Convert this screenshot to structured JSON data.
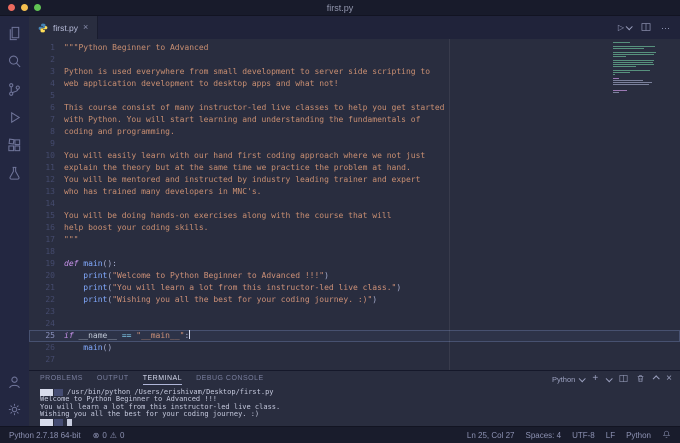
{
  "window": {
    "title": "first.py"
  },
  "colors": {
    "traffic_red": "#ec6a5e",
    "traffic_yellow": "#f4bf4f",
    "traffic_green": "#61c454",
    "editor_bg": "#292d3f",
    "keyword": "#c792ea",
    "string": "#ce9178",
    "function": "#82aaff",
    "operator": "#89ddff"
  },
  "activity_bar": {
    "items": [
      "explorer",
      "search",
      "source-control",
      "run-and-debug",
      "extensions",
      "testing"
    ],
    "bottom_items": [
      "account",
      "settings"
    ]
  },
  "tab_bar": {
    "tabs": [
      {
        "label": "first.py",
        "active": true
      }
    ],
    "actions": {
      "run": "▷",
      "more": "···"
    }
  },
  "editor": {
    "current_line": 25,
    "ruler_column": 80,
    "lines": [
      {
        "n": 1,
        "t": [
          [
            "ds",
            "\"\"\"Python Beginner to Advanced"
          ]
        ]
      },
      {
        "n": 2,
        "t": []
      },
      {
        "n": 3,
        "t": [
          [
            "ds",
            "Python is used everywhere from small development to server side scripting to"
          ]
        ]
      },
      {
        "n": 4,
        "t": [
          [
            "ds",
            "web application development to desktop apps and what not!"
          ]
        ]
      },
      {
        "n": 5,
        "t": []
      },
      {
        "n": 6,
        "t": [
          [
            "ds",
            "This course consist of many instructor-led live classes to help you get started"
          ]
        ]
      },
      {
        "n": 7,
        "t": [
          [
            "ds",
            "with Python. You will start learning and understanding the fundamentals of"
          ]
        ]
      },
      {
        "n": 8,
        "t": [
          [
            "ds",
            "coding and programming."
          ]
        ]
      },
      {
        "n": 9,
        "t": []
      },
      {
        "n": 10,
        "t": [
          [
            "ds",
            "You will easily learn with our hand first coding approach where we not just"
          ]
        ]
      },
      {
        "n": 11,
        "t": [
          [
            "ds",
            "explain the theory but at the same time we practice the problem at hand."
          ]
        ]
      },
      {
        "n": 12,
        "t": [
          [
            "ds",
            "You will be mentored and instructed by industry leading trainer and expert"
          ]
        ]
      },
      {
        "n": 13,
        "t": [
          [
            "ds",
            "who has trained many developers in MNC's."
          ]
        ]
      },
      {
        "n": 14,
        "t": []
      },
      {
        "n": 15,
        "t": [
          [
            "ds",
            "You will be doing hands-on exercises along with the course that will"
          ]
        ]
      },
      {
        "n": 16,
        "t": [
          [
            "ds",
            "help boost your coding skills."
          ]
        ]
      },
      {
        "n": 17,
        "t": [
          [
            "ds",
            "\"\"\""
          ]
        ]
      },
      {
        "n": 18,
        "t": []
      },
      {
        "n": 19,
        "t": [
          [
            "kw",
            "def "
          ],
          [
            "fn",
            "main"
          ],
          [
            "pl",
            "():"
          ]
        ]
      },
      {
        "n": 20,
        "t": [
          [
            "pl",
            "    "
          ],
          [
            "fn",
            "print"
          ],
          [
            "pl",
            "("
          ],
          [
            "str",
            "\"Welcome to Python Beginner to Advanced !!!\""
          ],
          [
            "pl",
            ")"
          ]
        ]
      },
      {
        "n": 21,
        "t": [
          [
            "pl",
            "    "
          ],
          [
            "fn",
            "print"
          ],
          [
            "pl",
            "("
          ],
          [
            "str",
            "\"You will learn a lot from this instructor-led live class.\""
          ],
          [
            "pl",
            ")"
          ]
        ]
      },
      {
        "n": 22,
        "t": [
          [
            "pl",
            "    "
          ],
          [
            "fn",
            "print"
          ],
          [
            "pl",
            "("
          ],
          [
            "str",
            "\"Wishing you all the best for your coding journey. :)\""
          ],
          [
            "pl",
            ")"
          ]
        ]
      },
      {
        "n": 23,
        "t": []
      },
      {
        "n": 24,
        "t": []
      },
      {
        "n": 25,
        "t": [
          [
            "kw",
            "if "
          ],
          [
            "var",
            "__name__"
          ],
          [
            "pl",
            " "
          ],
          [
            "op",
            "=="
          ],
          [
            "pl",
            " "
          ],
          [
            "str",
            "\"__main__\""
          ],
          [
            "pl",
            ":"
          ]
        ]
      },
      {
        "n": 26,
        "t": [
          [
            "pl",
            "    "
          ],
          [
            "fn",
            "main"
          ],
          [
            "pl",
            "()"
          ]
        ]
      },
      {
        "n": 27,
        "t": []
      }
    ]
  },
  "panel": {
    "tabs": [
      {
        "label": "PROBLEMS",
        "active": false
      },
      {
        "label": "OUTPUT",
        "active": false
      },
      {
        "label": "TERMINAL",
        "active": true
      },
      {
        "label": "DEBUG CONSOLE",
        "active": false
      }
    ],
    "shell": {
      "label": "Python"
    },
    "terminal": {
      "command": "/usr/bin/python /Users/erishivam/Desktop/first.py",
      "output": [
        "Welcome to Python Beginner to Advanced !!!",
        "You will learn a lot from this instructor-led live class.",
        "Wishing you all the best for your coding journey. :)"
      ]
    }
  },
  "status_bar": {
    "interpreter": "Python 2.7.18 64-bit",
    "errors": "0",
    "warnings": "0",
    "cursor": "Ln 25, Col 27",
    "indent": "Spaces: 4",
    "encoding": "UTF-8",
    "eol": "LF",
    "language": "Python"
  }
}
